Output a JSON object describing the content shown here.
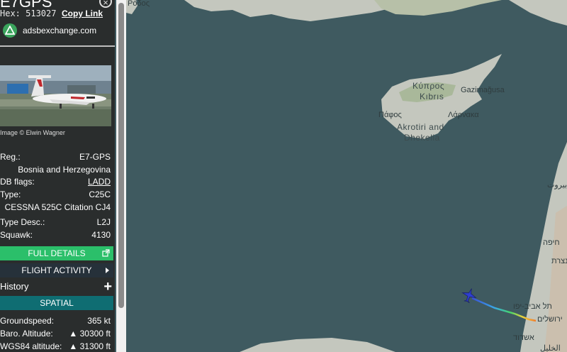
{
  "panel": {
    "title": "E7GPS",
    "close_glyph": "×",
    "hex_label": "Hex: 513027",
    "copy_link": "Copy Link",
    "source_name": "adsbexchange.com",
    "source_icon": "adsbexchange-logo-icon",
    "image_credit": "Image © Elwin Wagner",
    "fields": {
      "reg_key": "Reg.:",
      "reg_val": "E7-GPS",
      "country": "Bosnia and Herzegovina",
      "db_flags_key": "DB flags:",
      "db_flags_val": "LADD",
      "type_key": "Type:",
      "type_val": "C25C",
      "type_full": "CESSNA 525C Citation CJ4",
      "type_desc_key": "Type Desc.:",
      "type_desc_val": "L2J",
      "squawk_key": "Squawk:",
      "squawk_val": "4130"
    },
    "buttons": {
      "full_details": "FULL DETAILS",
      "flight_activity": "FLIGHT ACTIVITY",
      "history": "History",
      "spatial": "SPATIAL"
    },
    "spatial": {
      "groundspeed_key": "Groundspeed:",
      "groundspeed_val": "365 kt",
      "baro_key": "Baro. Altitude:",
      "baro_val": "▲ 30300 ft",
      "wgs_key": "WGS84 altitude:",
      "wgs_val": "▲ 31300 ft"
    },
    "colors": {
      "panel_bg": "#2a2d2d",
      "green_button": "#2bbf6a",
      "teal_button": "#0f6d72",
      "sea": "#3f5a60",
      "land": "#c4c7be"
    }
  },
  "map": {
    "labels": {
      "rodos": "Ρόδος",
      "kypros": "Κύπρος",
      "kibris": "Kıbrıs",
      "gazimagusa": "Gazimağusa",
      "pafos": "Πάφος",
      "larnaka": "Λάρνακα",
      "akrotiri": "Akrotiri and",
      "dhekelia": "Dhekelia",
      "beirut": "بيروت",
      "haifa": "חיפה",
      "telaviv": "תל אביב-יפו",
      "jerusalem": "ירושלים",
      "ashdod": "אשדוד",
      "nazareth": "נצרת",
      "hebron": "الخليل"
    },
    "aircraft_icon": "airplane-icon"
  }
}
